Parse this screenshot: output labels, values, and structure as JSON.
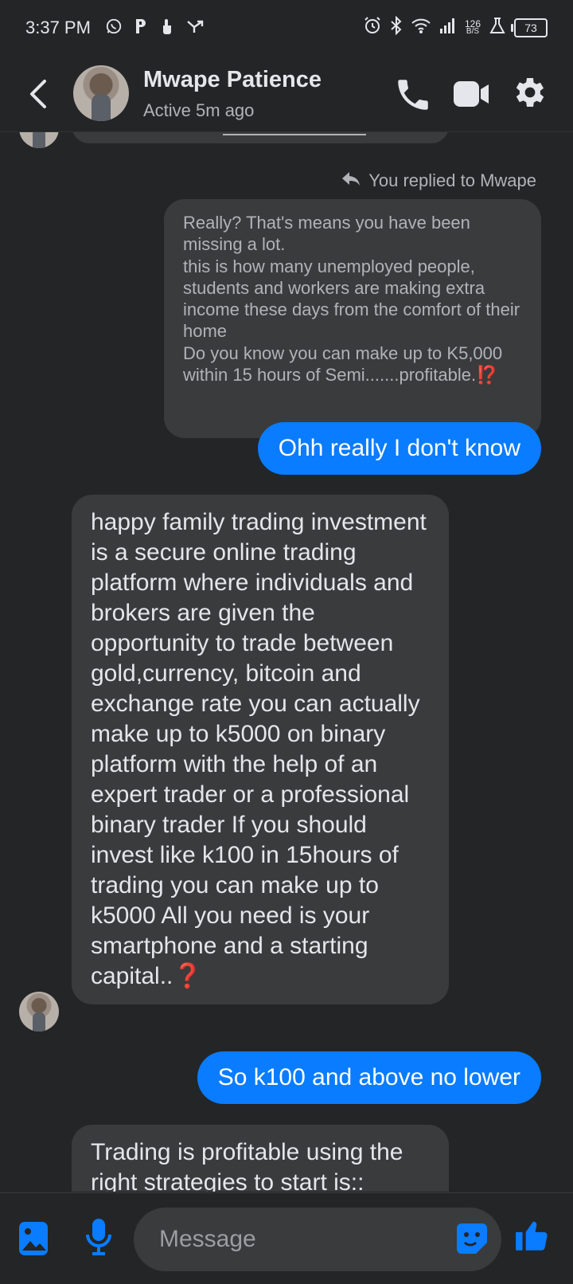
{
  "status_bar": {
    "time": "3:37 PM",
    "left_icons": [
      "whatsapp-icon",
      "p-icon",
      "touch-icon",
      "y-icon"
    ],
    "net_speed_value": "126",
    "net_speed_unit": "B/S",
    "battery": "73"
  },
  "header": {
    "contact_name": "Mwape Patience",
    "contact_status": "Active 5m ago",
    "accent_color": "#0a7cff"
  },
  "chat": {
    "reply_label": "You replied to Mwape",
    "quoted_message": "Really? That's means you have been missing a lot.\nthis is how many unemployed people, students and workers are making extra income these days from the comfort of their home\nDo you know you can make up to K5,000 within 15 hours of Semi.......profitable.⁉️",
    "messages": [
      {
        "from": "me",
        "text": "Ohh really I don't know"
      },
      {
        "from": "them",
        "text": "happy family trading investment is a secure online trading platform where individuals and brokers are given the opportunity to trade between gold,currency, bitcoin and exchange rate you can actually make up to k5000 on binary platform with the help of an expert trader or a professional binary trader If you should invest like k100 in 15hours  of trading you can make up to k5000 All you need is your smartphone and a starting capital..❓"
      },
      {
        "from": "me",
        "text": "So k100 and above no lower"
      },
      {
        "from": "them",
        "text": "Trading is profitable using the right strategies to start is::"
      }
    ]
  },
  "composer": {
    "placeholder": "Message"
  }
}
